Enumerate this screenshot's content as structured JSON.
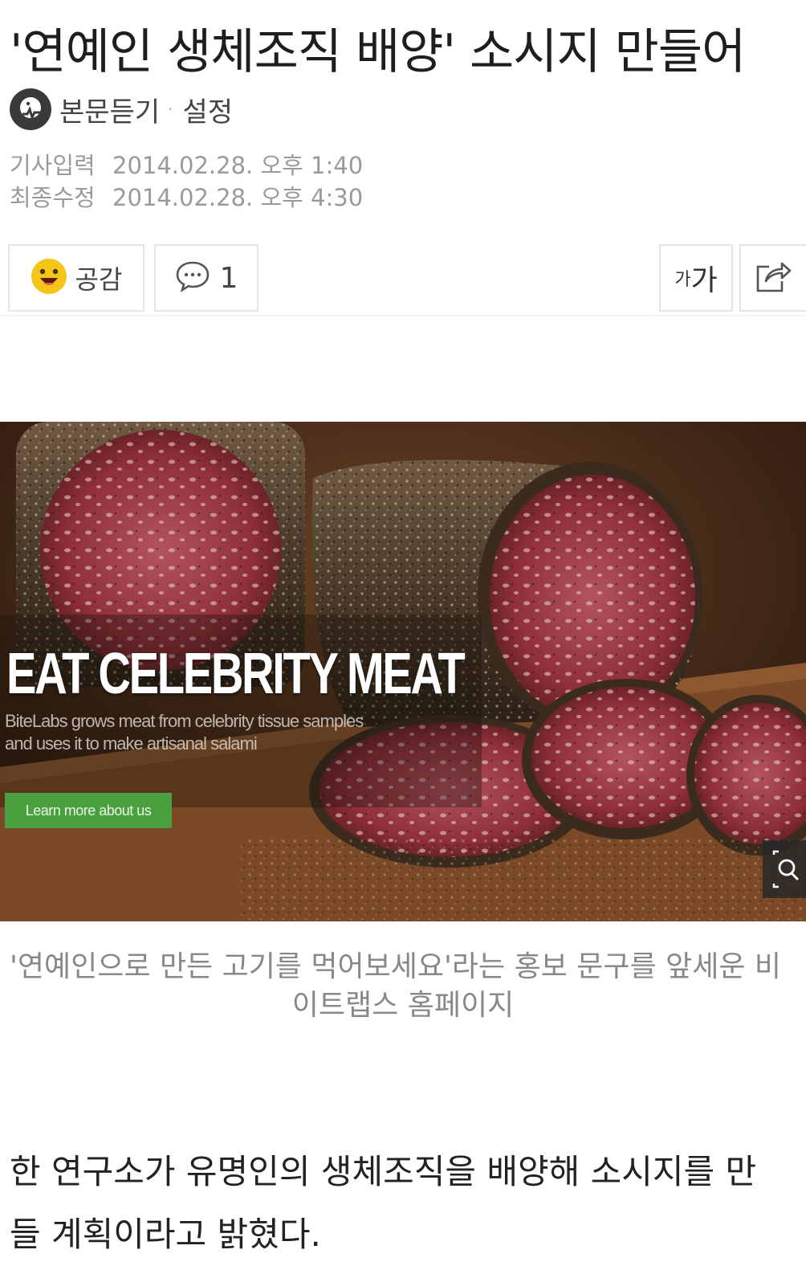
{
  "article": {
    "headline": "'연예인 생체조직 배양' 소시지 만들어",
    "listen_label": "본문듣기",
    "separator": "·",
    "settings_label": "설정",
    "dates": [
      {
        "label": "기사입력",
        "value": "2014.02.28. 오후 1:40"
      },
      {
        "label": "최종수정",
        "value": "2014.02.28. 오후 4:30"
      }
    ]
  },
  "toolbar": {
    "like_label": "공감",
    "comment_count": "1",
    "font_small": "가",
    "font_large": "가",
    "like_icon": "smile-emoji-icon",
    "comment_icon": "speech-bubble-icon",
    "share_icon": "share-icon"
  },
  "photo": {
    "headline": "EAT CELEBRITY MEAT",
    "sub_line1": "BiteLabs grows meat from celebrity tissue samples",
    "sub_line2": "and uses it to make artisanal salami",
    "cta": "Learn more about us",
    "zoom_icon": "zoom-icon"
  },
  "caption": {
    "line1": "'연예인으로 만든 고기를 먹어보세요'라는 홍보 문구를 앞세운 비",
    "line2": "이트랩스 홈페이지"
  },
  "body": {
    "line1": "한 연구소가 유명인의 생체조직을 배양해 소시지를 만",
    "line2": "들 계획이라고 밝혔다."
  },
  "colors": {
    "cta_green": "#4aa03f",
    "emoji_yellow": "#f5c518",
    "meta_gray": "#9a9a9a"
  }
}
